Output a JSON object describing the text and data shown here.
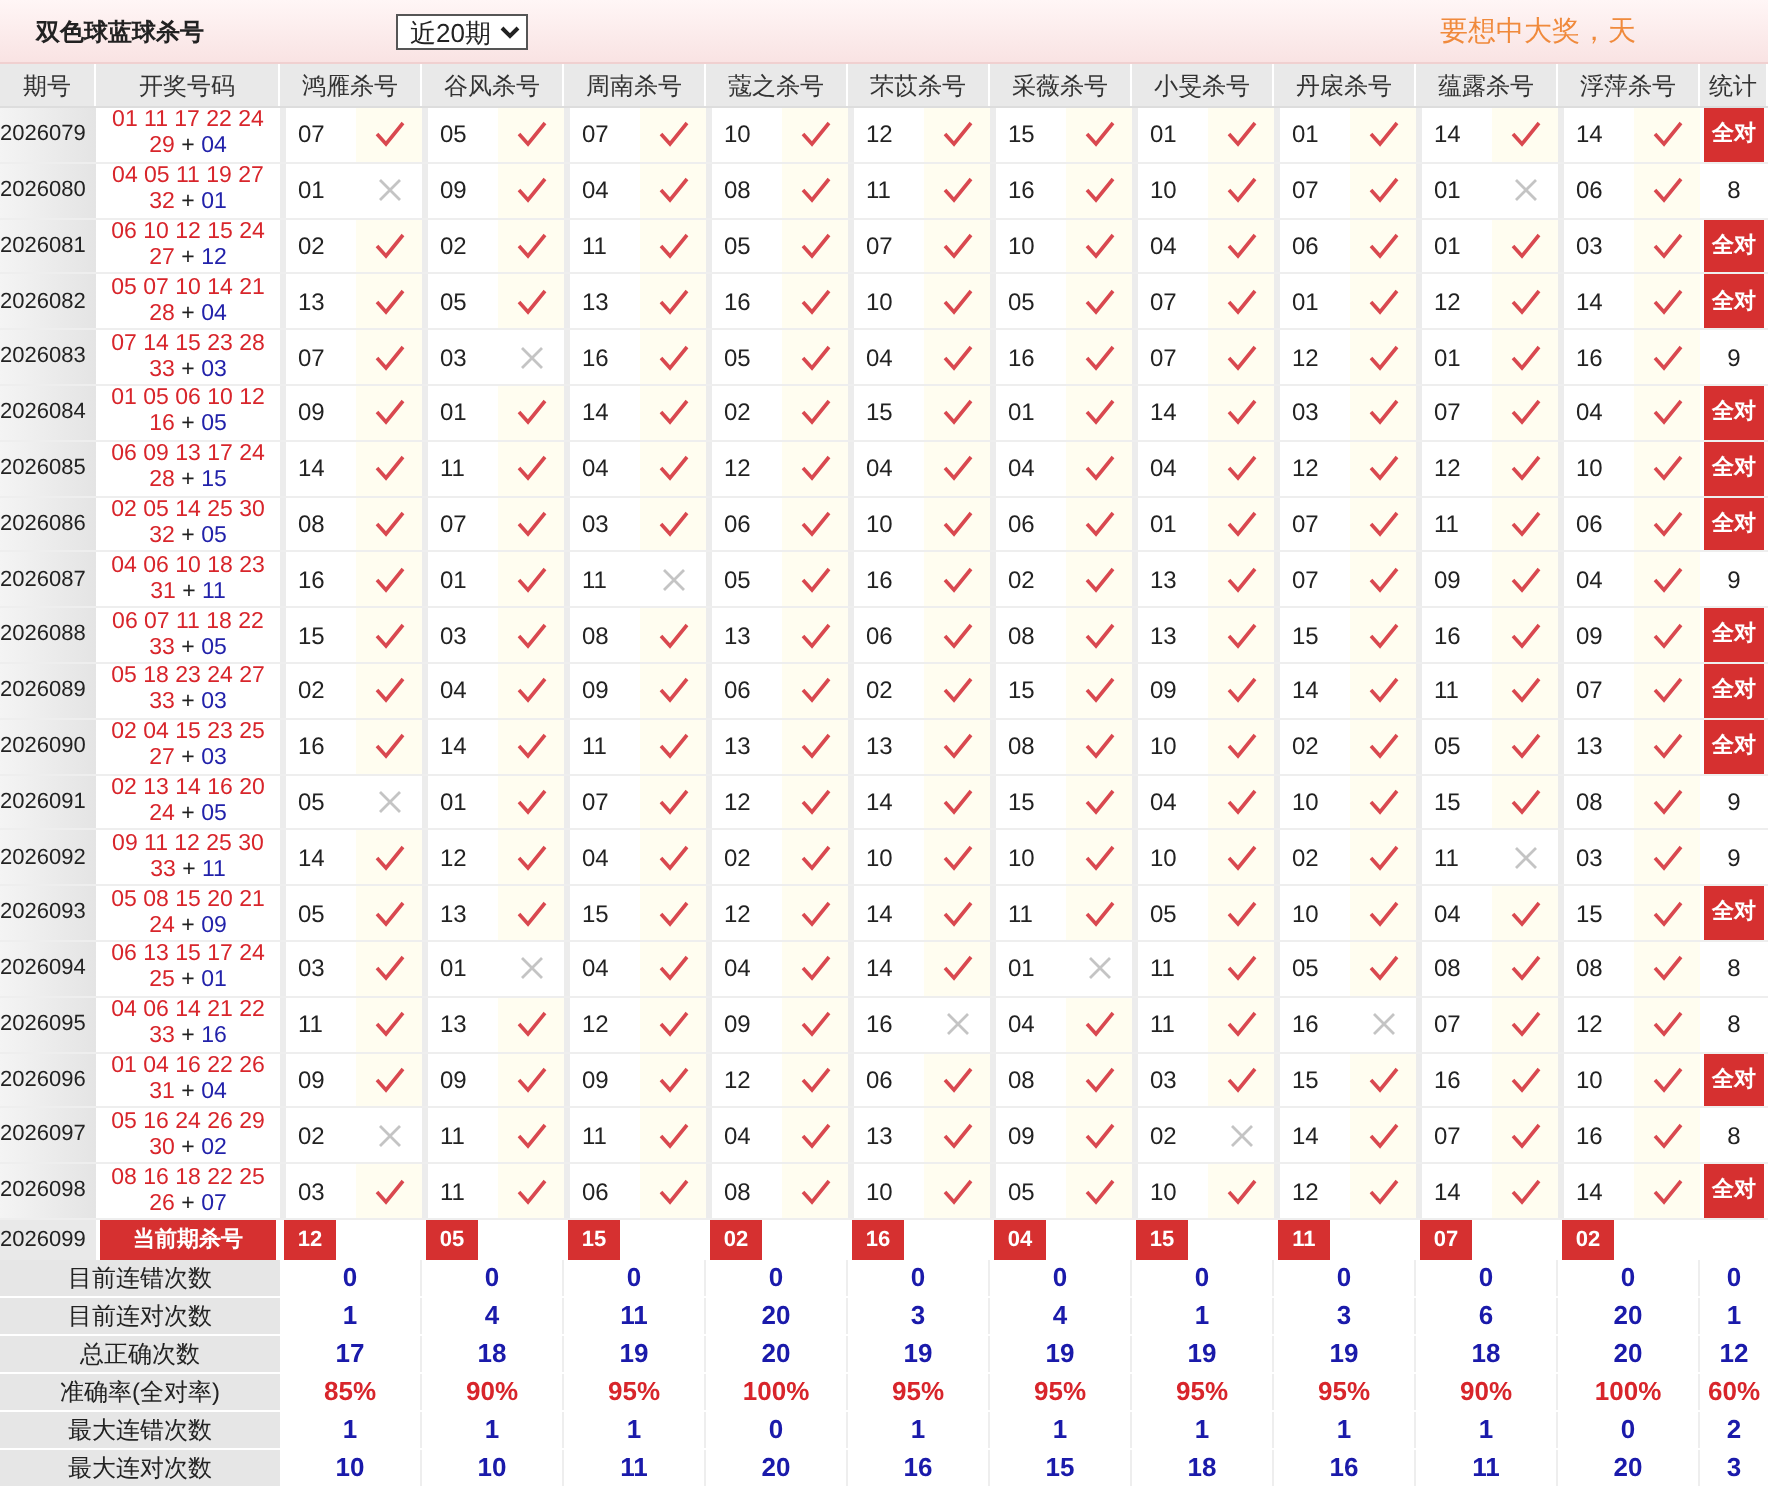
{
  "header": {
    "title": "双色球蓝球杀号",
    "range": "近20期",
    "notice": "要想中大奖，天"
  },
  "columns": [
    "期号",
    "开奖号码",
    "鸿雁杀号",
    "谷风杀号",
    "周南杀号",
    "蔻之杀号",
    "芣苡杀号",
    "采薇杀号",
    "小旻杀号",
    "丹扆杀号",
    "蕴露杀号",
    "浮萍杀号",
    "统计"
  ],
  "rows": [
    {
      "period": "2026079",
      "reds": "01 11 17 22 24 29",
      "plus": "+",
      "blue": "04",
      "picks": [
        {
          "number": "07",
          "hit": true
        },
        {
          "number": "05",
          "hit": true
        },
        {
          "number": "07",
          "hit": true
        },
        {
          "number": "10",
          "hit": true
        },
        {
          "number": "12",
          "hit": true
        },
        {
          "number": "15",
          "hit": true
        },
        {
          "number": "01",
          "hit": true
        },
        {
          "number": "01",
          "hit": true
        },
        {
          "number": "14",
          "hit": true
        },
        {
          "number": "14",
          "hit": true
        }
      ],
      "stat": "全对",
      "all_hit": true
    },
    {
      "period": "2026080",
      "reds": "04 05 11 19 27 32",
      "plus": "+",
      "blue": "01",
      "picks": [
        {
          "number": "01",
          "hit": false
        },
        {
          "number": "09",
          "hit": true
        },
        {
          "number": "04",
          "hit": true
        },
        {
          "number": "08",
          "hit": true
        },
        {
          "number": "11",
          "hit": true
        },
        {
          "number": "16",
          "hit": true
        },
        {
          "number": "10",
          "hit": true
        },
        {
          "number": "07",
          "hit": true
        },
        {
          "number": "01",
          "hit": false
        },
        {
          "number": "06",
          "hit": true
        }
      ],
      "stat": "8",
      "all_hit": false
    },
    {
      "period": "2026081",
      "reds": "06 10 12 15 24 27",
      "plus": "+",
      "blue": "12",
      "picks": [
        {
          "number": "02",
          "hit": true
        },
        {
          "number": "02",
          "hit": true
        },
        {
          "number": "11",
          "hit": true
        },
        {
          "number": "05",
          "hit": true
        },
        {
          "number": "07",
          "hit": true
        },
        {
          "number": "10",
          "hit": true
        },
        {
          "number": "04",
          "hit": true
        },
        {
          "number": "06",
          "hit": true
        },
        {
          "number": "01",
          "hit": true
        },
        {
          "number": "03",
          "hit": true
        }
      ],
      "stat": "全对",
      "all_hit": true
    },
    {
      "period": "2026082",
      "reds": "05 07 10 14 21 28",
      "plus": "+",
      "blue": "04",
      "picks": [
        {
          "number": "13",
          "hit": true
        },
        {
          "number": "05",
          "hit": true
        },
        {
          "number": "13",
          "hit": true
        },
        {
          "number": "16",
          "hit": true
        },
        {
          "number": "10",
          "hit": true
        },
        {
          "number": "05",
          "hit": true
        },
        {
          "number": "07",
          "hit": true
        },
        {
          "number": "01",
          "hit": true
        },
        {
          "number": "12",
          "hit": true
        },
        {
          "number": "14",
          "hit": true
        }
      ],
      "stat": "全对",
      "all_hit": true
    },
    {
      "period": "2026083",
      "reds": "07 14 15 23 28 33",
      "plus": "+",
      "blue": "03",
      "picks": [
        {
          "number": "07",
          "hit": true
        },
        {
          "number": "03",
          "hit": false
        },
        {
          "number": "16",
          "hit": true
        },
        {
          "number": "05",
          "hit": true
        },
        {
          "number": "04",
          "hit": true
        },
        {
          "number": "16",
          "hit": true
        },
        {
          "number": "07",
          "hit": true
        },
        {
          "number": "12",
          "hit": true
        },
        {
          "number": "01",
          "hit": true
        },
        {
          "number": "16",
          "hit": true
        }
      ],
      "stat": "9",
      "all_hit": false
    },
    {
      "period": "2026084",
      "reds": "01 05 06 10 12 16",
      "plus": "+",
      "blue": "05",
      "picks": [
        {
          "number": "09",
          "hit": true
        },
        {
          "number": "01",
          "hit": true
        },
        {
          "number": "14",
          "hit": true
        },
        {
          "number": "02",
          "hit": true
        },
        {
          "number": "15",
          "hit": true
        },
        {
          "number": "01",
          "hit": true
        },
        {
          "number": "14",
          "hit": true
        },
        {
          "number": "03",
          "hit": true
        },
        {
          "number": "07",
          "hit": true
        },
        {
          "number": "04",
          "hit": true
        }
      ],
      "stat": "全对",
      "all_hit": true
    },
    {
      "period": "2026085",
      "reds": "06 09 13 17 24 28",
      "plus": "+",
      "blue": "15",
      "picks": [
        {
          "number": "14",
          "hit": true
        },
        {
          "number": "11",
          "hit": true
        },
        {
          "number": "04",
          "hit": true
        },
        {
          "number": "12",
          "hit": true
        },
        {
          "number": "04",
          "hit": true
        },
        {
          "number": "04",
          "hit": true
        },
        {
          "number": "04",
          "hit": true
        },
        {
          "number": "12",
          "hit": true
        },
        {
          "number": "12",
          "hit": true
        },
        {
          "number": "10",
          "hit": true
        }
      ],
      "stat": "全对",
      "all_hit": true
    },
    {
      "period": "2026086",
      "reds": "02 05 14 25 30 32",
      "plus": "+",
      "blue": "05",
      "picks": [
        {
          "number": "08",
          "hit": true
        },
        {
          "number": "07",
          "hit": true
        },
        {
          "number": "03",
          "hit": true
        },
        {
          "number": "06",
          "hit": true
        },
        {
          "number": "10",
          "hit": true
        },
        {
          "number": "06",
          "hit": true
        },
        {
          "number": "01",
          "hit": true
        },
        {
          "number": "07",
          "hit": true
        },
        {
          "number": "11",
          "hit": true
        },
        {
          "number": "06",
          "hit": true
        }
      ],
      "stat": "全对",
      "all_hit": true
    },
    {
      "period": "2026087",
      "reds": "04 06 10 18 23 31",
      "plus": "+",
      "blue": "11",
      "picks": [
        {
          "number": "16",
          "hit": true
        },
        {
          "number": "01",
          "hit": true
        },
        {
          "number": "11",
          "hit": false
        },
        {
          "number": "05",
          "hit": true
        },
        {
          "number": "16",
          "hit": true
        },
        {
          "number": "02",
          "hit": true
        },
        {
          "number": "13",
          "hit": true
        },
        {
          "number": "07",
          "hit": true
        },
        {
          "number": "09",
          "hit": true
        },
        {
          "number": "04",
          "hit": true
        }
      ],
      "stat": "9",
      "all_hit": false
    },
    {
      "period": "2026088",
      "reds": "06 07 11 18 22 33",
      "plus": "+",
      "blue": "05",
      "picks": [
        {
          "number": "15",
          "hit": true
        },
        {
          "number": "03",
          "hit": true
        },
        {
          "number": "08",
          "hit": true
        },
        {
          "number": "13",
          "hit": true
        },
        {
          "number": "06",
          "hit": true
        },
        {
          "number": "08",
          "hit": true
        },
        {
          "number": "13",
          "hit": true
        },
        {
          "number": "15",
          "hit": true
        },
        {
          "number": "16",
          "hit": true
        },
        {
          "number": "09",
          "hit": true
        }
      ],
      "stat": "全对",
      "all_hit": true
    },
    {
      "period": "2026089",
      "reds": "05 18 23 24 27 33",
      "plus": "+",
      "blue": "03",
      "picks": [
        {
          "number": "02",
          "hit": true
        },
        {
          "number": "04",
          "hit": true
        },
        {
          "number": "09",
          "hit": true
        },
        {
          "number": "06",
          "hit": true
        },
        {
          "number": "02",
          "hit": true
        },
        {
          "number": "15",
          "hit": true
        },
        {
          "number": "09",
          "hit": true
        },
        {
          "number": "14",
          "hit": true
        },
        {
          "number": "11",
          "hit": true
        },
        {
          "number": "07",
          "hit": true
        }
      ],
      "stat": "全对",
      "all_hit": true
    },
    {
      "period": "2026090",
      "reds": "02 04 15 23 25 27",
      "plus": "+",
      "blue": "03",
      "picks": [
        {
          "number": "16",
          "hit": true
        },
        {
          "number": "14",
          "hit": true
        },
        {
          "number": "11",
          "hit": true
        },
        {
          "number": "13",
          "hit": true
        },
        {
          "number": "13",
          "hit": true
        },
        {
          "number": "08",
          "hit": true
        },
        {
          "number": "10",
          "hit": true
        },
        {
          "number": "02",
          "hit": true
        },
        {
          "number": "05",
          "hit": true
        },
        {
          "number": "13",
          "hit": true
        }
      ],
      "stat": "全对",
      "all_hit": true
    },
    {
      "period": "2026091",
      "reds": "02 13 14 16 20 24",
      "plus": "+",
      "blue": "05",
      "picks": [
        {
          "number": "05",
          "hit": false
        },
        {
          "number": "01",
          "hit": true
        },
        {
          "number": "07",
          "hit": true
        },
        {
          "number": "12",
          "hit": true
        },
        {
          "number": "14",
          "hit": true
        },
        {
          "number": "15",
          "hit": true
        },
        {
          "number": "04",
          "hit": true
        },
        {
          "number": "10",
          "hit": true
        },
        {
          "number": "15",
          "hit": true
        },
        {
          "number": "08",
          "hit": true
        }
      ],
      "stat": "9",
      "all_hit": false
    },
    {
      "period": "2026092",
      "reds": "09 11 12 25 30 33",
      "plus": "+",
      "blue": "11",
      "picks": [
        {
          "number": "14",
          "hit": true
        },
        {
          "number": "12",
          "hit": true
        },
        {
          "number": "04",
          "hit": true
        },
        {
          "number": "02",
          "hit": true
        },
        {
          "number": "10",
          "hit": true
        },
        {
          "number": "10",
          "hit": true
        },
        {
          "number": "10",
          "hit": true
        },
        {
          "number": "02",
          "hit": true
        },
        {
          "number": "11",
          "hit": false
        },
        {
          "number": "03",
          "hit": true
        }
      ],
      "stat": "9",
      "all_hit": false
    },
    {
      "period": "2026093",
      "reds": "05 08 15 20 21 24",
      "plus": "+",
      "blue": "09",
      "picks": [
        {
          "number": "05",
          "hit": true
        },
        {
          "number": "13",
          "hit": true
        },
        {
          "number": "15",
          "hit": true
        },
        {
          "number": "12",
          "hit": true
        },
        {
          "number": "14",
          "hit": true
        },
        {
          "number": "11",
          "hit": true
        },
        {
          "number": "05",
          "hit": true
        },
        {
          "number": "10",
          "hit": true
        },
        {
          "number": "04",
          "hit": true
        },
        {
          "number": "15",
          "hit": true
        }
      ],
      "stat": "全对",
      "all_hit": true
    },
    {
      "period": "2026094",
      "reds": "06 13 15 17 24 25",
      "plus": "+",
      "blue": "01",
      "picks": [
        {
          "number": "03",
          "hit": true
        },
        {
          "number": "01",
          "hit": false
        },
        {
          "number": "04",
          "hit": true
        },
        {
          "number": "04",
          "hit": true
        },
        {
          "number": "14",
          "hit": true
        },
        {
          "number": "01",
          "hit": false
        },
        {
          "number": "11",
          "hit": true
        },
        {
          "number": "05",
          "hit": true
        },
        {
          "number": "08",
          "hit": true
        },
        {
          "number": "08",
          "hit": true
        }
      ],
      "stat": "8",
      "all_hit": false
    },
    {
      "period": "2026095",
      "reds": "04 06 14 21 22 33",
      "plus": "+",
      "blue": "16",
      "picks": [
        {
          "number": "11",
          "hit": true
        },
        {
          "number": "13",
          "hit": true
        },
        {
          "number": "12",
          "hit": true
        },
        {
          "number": "09",
          "hit": true
        },
        {
          "number": "16",
          "hit": false
        },
        {
          "number": "04",
          "hit": true
        },
        {
          "number": "11",
          "hit": true
        },
        {
          "number": "16",
          "hit": false
        },
        {
          "number": "07",
          "hit": true
        },
        {
          "number": "12",
          "hit": true
        }
      ],
      "stat": "8",
      "all_hit": false
    },
    {
      "period": "2026096",
      "reds": "01 04 16 22 26 31",
      "plus": "+",
      "blue": "04",
      "picks": [
        {
          "number": "09",
          "hit": true
        },
        {
          "number": "09",
          "hit": true
        },
        {
          "number": "09",
          "hit": true
        },
        {
          "number": "12",
          "hit": true
        },
        {
          "number": "06",
          "hit": true
        },
        {
          "number": "08",
          "hit": true
        },
        {
          "number": "03",
          "hit": true
        },
        {
          "number": "15",
          "hit": true
        },
        {
          "number": "16",
          "hit": true
        },
        {
          "number": "10",
          "hit": true
        }
      ],
      "stat": "全对",
      "all_hit": true
    },
    {
      "period": "2026097",
      "reds": "05 16 24 26 29 30",
      "plus": "+",
      "blue": "02",
      "picks": [
        {
          "number": "02",
          "hit": false
        },
        {
          "number": "11",
          "hit": true
        },
        {
          "number": "11",
          "hit": true
        },
        {
          "number": "04",
          "hit": true
        },
        {
          "number": "13",
          "hit": true
        },
        {
          "number": "09",
          "hit": true
        },
        {
          "number": "02",
          "hit": false
        },
        {
          "number": "14",
          "hit": true
        },
        {
          "number": "07",
          "hit": true
        },
        {
          "number": "16",
          "hit": true
        }
      ],
      "stat": "8",
      "all_hit": false
    },
    {
      "period": "2026098",
      "reds": "08 16 18 22 25 26",
      "plus": "+",
      "blue": "07",
      "picks": [
        {
          "number": "03",
          "hit": true
        },
        {
          "number": "11",
          "hit": true
        },
        {
          "number": "06",
          "hit": true
        },
        {
          "number": "08",
          "hit": true
        },
        {
          "number": "10",
          "hit": true
        },
        {
          "number": "05",
          "hit": true
        },
        {
          "number": "10",
          "hit": true
        },
        {
          "number": "12",
          "hit": true
        },
        {
          "number": "14",
          "hit": true
        },
        {
          "number": "14",
          "hit": true
        }
      ],
      "stat": "全对",
      "all_hit": true
    }
  ],
  "current": {
    "period": "2026099",
    "label": "当前期杀号",
    "picks": [
      "12",
      "05",
      "15",
      "02",
      "16",
      "04",
      "15",
      "11",
      "07",
      "02"
    ]
  },
  "summary": [
    {
      "label": "目前连错次数",
      "values": [
        "0",
        "0",
        "0",
        "0",
        "0",
        "0",
        "0",
        "0",
        "0",
        "0",
        "0"
      ],
      "kind": "count"
    },
    {
      "label": "目前连对次数",
      "values": [
        "1",
        "4",
        "11",
        "20",
        "3",
        "4",
        "1",
        "3",
        "6",
        "20",
        "1"
      ],
      "kind": "count"
    },
    {
      "label": "总正确次数",
      "values": [
        "17",
        "18",
        "19",
        "20",
        "19",
        "19",
        "19",
        "19",
        "18",
        "20",
        "12"
      ],
      "kind": "count"
    },
    {
      "label": "准确率(全对率)",
      "values": [
        "85%",
        "90%",
        "95%",
        "100%",
        "95%",
        "95%",
        "95%",
        "95%",
        "90%",
        "100%",
        "60%"
      ],
      "kind": "rate"
    },
    {
      "label": "最大连错次数",
      "values": [
        "1",
        "1",
        "1",
        "0",
        "1",
        "1",
        "1",
        "1",
        "1",
        "0",
        "2"
      ],
      "kind": "count"
    },
    {
      "label": "最大连对次数",
      "values": [
        "10",
        "10",
        "11",
        "20",
        "16",
        "15",
        "18",
        "16",
        "11",
        "20",
        "3"
      ],
      "kind": "count"
    }
  ]
}
